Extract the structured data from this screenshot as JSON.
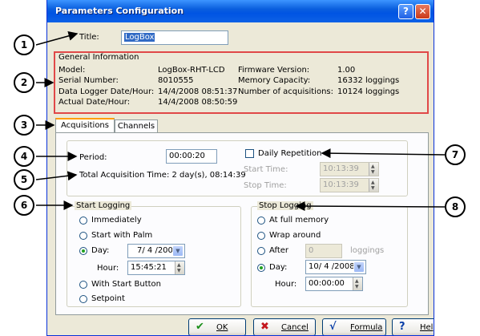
{
  "window": {
    "title": "Parameters Configuration",
    "help_glyph": "?",
    "close_glyph": "✕"
  },
  "title_field": {
    "label": "Title:",
    "value": "LogBox"
  },
  "general": {
    "group_label": "General Information",
    "left": [
      {
        "label": "Model:",
        "value": "LogBox-RHT-LCD"
      },
      {
        "label": "Serial Number:",
        "value": "8010555"
      },
      {
        "label": "Data Logger Date/Hour:",
        "value": "14/4/2008 08:51:37"
      },
      {
        "label": "Actual Date/Hour:",
        "value": "14/4/2008 08:50:59"
      }
    ],
    "right": [
      {
        "label": "Firmware Version:",
        "value": "1.00"
      },
      {
        "label": "Memory Capacity:",
        "value": "16332 loggings"
      },
      {
        "label": "Number of acquisitions:",
        "value": "10124 loggings"
      }
    ]
  },
  "tabs": [
    {
      "label": "Acquisitions"
    },
    {
      "label": "Channels"
    }
  ],
  "acquisition": {
    "period_label": "Period:",
    "period_value": "00:00:20",
    "total_time": "Total Acquisition Time: 2 day(s), 08:14:39",
    "daily_repetition_label": "Daily Repetition",
    "daily_repetition_checked": false,
    "start_time_label": "Start Time:",
    "start_time_value": "10:13:39",
    "stop_time_label": "Stop Time:",
    "stop_time_value": "10:13:39"
  },
  "start_logging": {
    "group_label": "Start Logging",
    "options": [
      "Immediately",
      "Start with Palm",
      "Day:",
      "With Start Button",
      "Setpoint"
    ],
    "selected": "Day:",
    "day_value": "7/ 4 /2008",
    "hour_label": "Hour:",
    "hour_value": "15:45:21"
  },
  "stop_logging": {
    "group_label": "Stop Logging",
    "options": [
      "At full memory",
      "Wrap around",
      "After",
      "Day:"
    ],
    "selected": "Day:",
    "after_value": "0",
    "after_unit": "loggings",
    "day_value": "10/ 4 /2008",
    "hour_label": "Hour:",
    "hour_value": "00:00:00"
  },
  "buttons": [
    {
      "label": "OK",
      "icon": "check-icon",
      "glyph": "✔",
      "color": "#1a8f1a"
    },
    {
      "label": "Cancel",
      "icon": "x-icon",
      "glyph": "✖",
      "color": "#c4161c"
    },
    {
      "label": "Formula",
      "icon": "formula-icon",
      "glyph": "√",
      "color": "#0a3fa8"
    },
    {
      "label": "Help",
      "icon": "question-icon",
      "glyph": "?",
      "color": "#0a3fa8"
    }
  ],
  "callouts": [
    "1",
    "2",
    "3",
    "4",
    "5",
    "6",
    "7",
    "8"
  ],
  "colors": {
    "accent_red": "#e04848",
    "titlebar_blue": "#0054e3"
  }
}
